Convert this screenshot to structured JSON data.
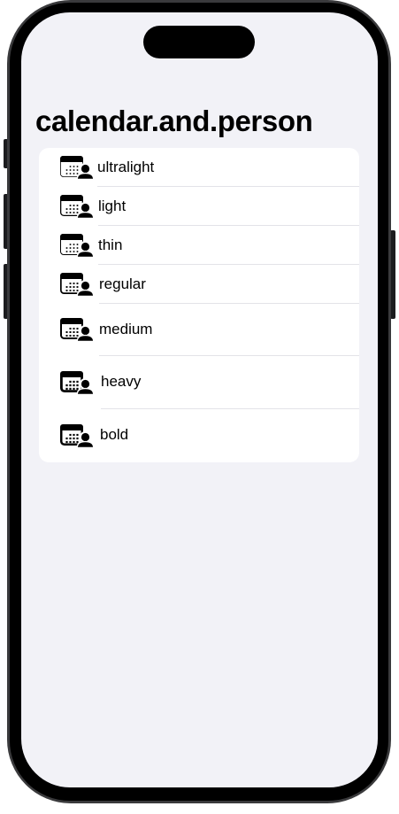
{
  "screen": {
    "title": "calendar.and.person",
    "background": "#f2f2f7",
    "card_background": "#ffffff"
  },
  "rows": [
    {
      "label": "ultralight",
      "icon": "calendar-and-person-icon",
      "weight": "ultralight"
    },
    {
      "label": "light",
      "icon": "calendar-and-person-icon",
      "weight": "light"
    },
    {
      "label": "thin",
      "icon": "calendar-and-person-icon",
      "weight": "thin"
    },
    {
      "label": "regular",
      "icon": "calendar-and-person-icon",
      "weight": "regular"
    },
    {
      "label": "medium",
      "icon": "calendar-and-person-icon",
      "weight": "medium"
    },
    {
      "label": "heavy",
      "icon": "calendar-and-person-icon",
      "weight": "heavy"
    },
    {
      "label": "bold",
      "icon": "calendar-and-person-icon",
      "weight": "bold"
    }
  ]
}
